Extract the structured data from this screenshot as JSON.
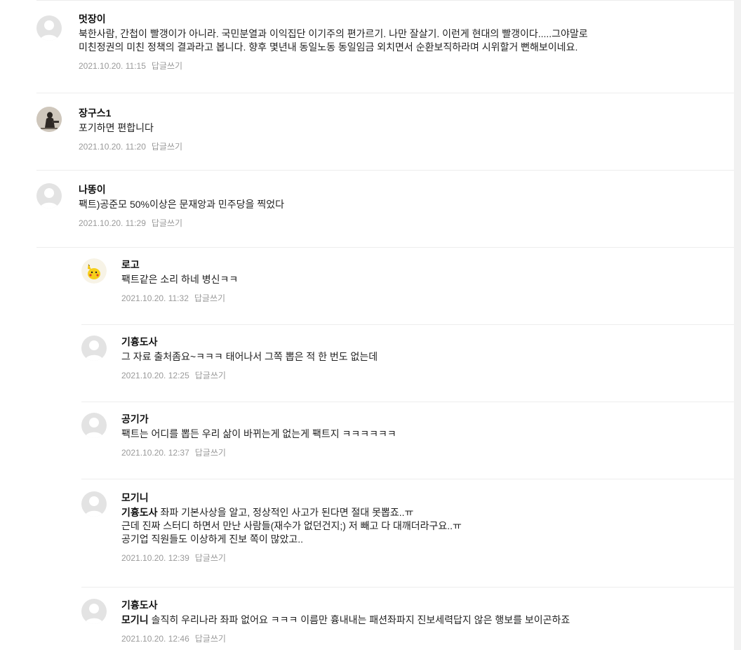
{
  "comments": [
    {
      "author": "멋장이",
      "lines": [
        "북한사람, 간첩이 빨갱이가 아니라. 국민분열과 이익집단 이기주의 편가르기. 나만 잘살기. 이런게 현대의 빨갱이다.....그야말로",
        "미친정권의 미친 정책의 결과라고 봅니다. 향후 몇년내 동일노동 동일임금 외치면서 순환보직하라며 시위할거 뻔해보이네요."
      ],
      "date": "2021.10.20. 11:15",
      "reply": "답글쓰기"
    },
    {
      "author": "장구스1",
      "lines": [
        "포기하면 편합니다"
      ],
      "date": "2021.10.20. 11:20",
      "reply": "답글쓰기"
    },
    {
      "author": "나똥이",
      "lines": [
        "팩트)공준모 50%이상은 문재앙과 민주당을 찍었다"
      ],
      "date": "2021.10.20. 11:29",
      "reply": "답글쓰기"
    },
    {
      "author": "로고",
      "lines": [
        "팩트같은 소리 하네 병신ㅋㅋ"
      ],
      "date": "2021.10.20. 11:32",
      "reply": "답글쓰기"
    },
    {
      "author": "기흉도사",
      "lines": [
        "그 자료 출처좀요~ㅋㅋㅋ 태어나서 그쪽 뽑은 적 한 번도 없는데"
      ],
      "date": "2021.10.20. 12:25",
      "reply": "답글쓰기"
    },
    {
      "author": "공기가",
      "lines": [
        "팩트는 어디를 뽑든 우리 삶이 바뀌는게 없는게 팩트지 ㅋㅋㅋㅋㅋㅋ"
      ],
      "date": "2021.10.20. 12:37",
      "reply": "답글쓰기"
    },
    {
      "author": "모기니",
      "mention": "기흉도사",
      "lines": [
        "좌파 기본사상을 알고, 정상적인 사고가 된다면 절대 못뽑죠..ㅠ",
        "근데 진짜 스터디 하면서 만난 사람들(재수가 없던건지;) 저 빼고 다 대깨더라구요..ㅠ",
        "공기업 직원들도 이상하게 진보 쪽이 많았고.."
      ],
      "date": "2021.10.20. 12:39",
      "reply": "답글쓰기"
    },
    {
      "author": "기흉도사",
      "mention": "모기니",
      "lines": [
        "솔직히 우리나라 좌파 없어요 ㅋㅋㅋ 이름만 흉내내는 패션좌파지 진보세력답지 않은 행보를 보이곤하죠"
      ],
      "date": "2021.10.20. 12:46",
      "reply": "답글쓰기"
    }
  ]
}
